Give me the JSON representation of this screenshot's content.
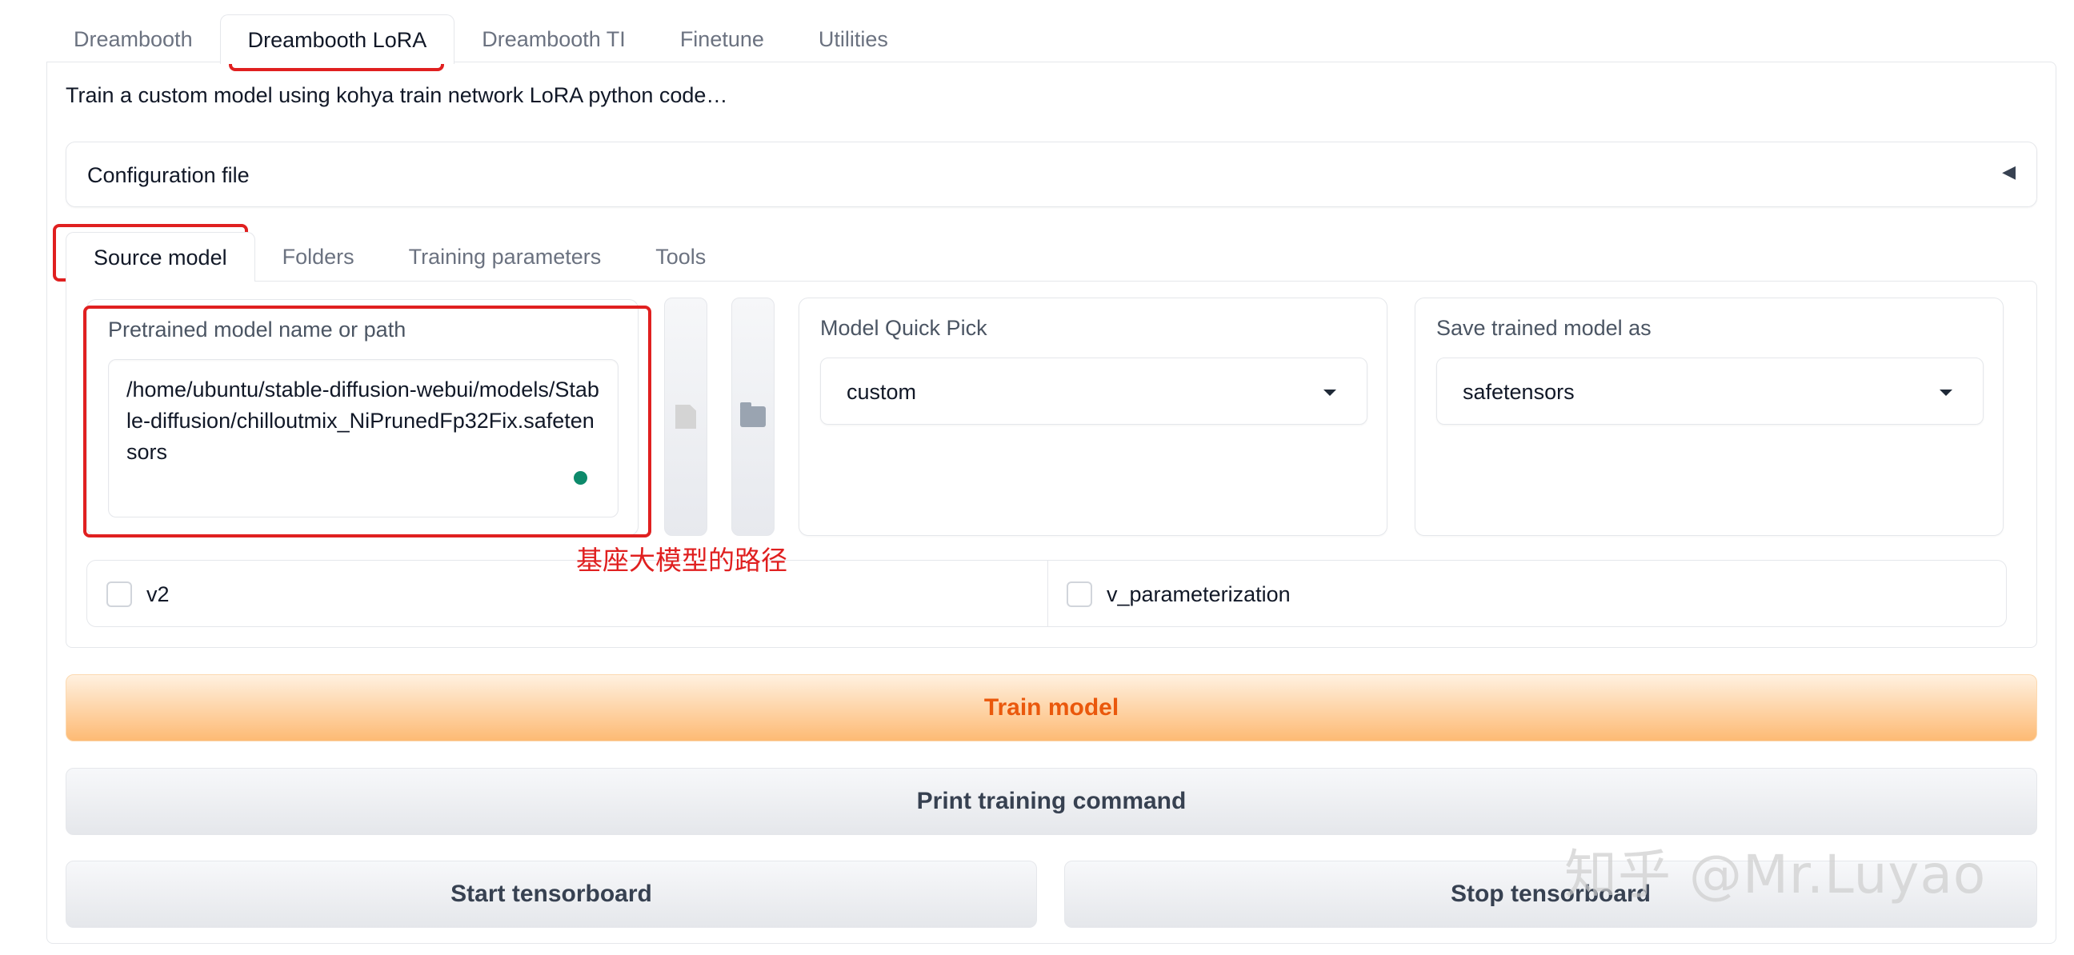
{
  "top_tabs": [
    "Dreambooth",
    "Dreambooth LoRA",
    "Dreambooth TI",
    "Finetune",
    "Utilities"
  ],
  "active_top_tab": "Dreambooth LoRA",
  "description": "Train a custom model using kohya train network LoRA python code…",
  "config": {
    "label": "Configuration file",
    "arrow": "◀"
  },
  "sub_tabs": [
    "Source model",
    "Folders",
    "Training parameters",
    "Tools"
  ],
  "active_sub_tab": "Source model",
  "pretrained": {
    "label": "Pretrained model name or path",
    "value": "/home/ubuntu/stable-diffusion-webui/models/Stable-diffusion/chilloutmix_NiPrunedFp32Fix.safetensors"
  },
  "icons": {
    "file_button": "file-icon",
    "folder_button": "folder-open-icon"
  },
  "quick_pick": {
    "label": "Model Quick Pick",
    "value": "custom"
  },
  "save_as": {
    "label": "Save trained model as",
    "value": "safetensors"
  },
  "checkboxes": {
    "v2": "v2",
    "v_param": "v_parameterization"
  },
  "annotation": "基座大模型的路径",
  "buttons": {
    "train": "Train model",
    "print": "Print training command",
    "start_tb": "Start tensorboard",
    "stop_tb": "Stop tensorboard"
  },
  "watermark": "知乎 @Mr.Luyao",
  "colors": {
    "annotation_red": "#e02020",
    "train_text": "#ea580c",
    "train_bg": "#fdba74",
    "dot_green": "#0d8a6b"
  }
}
